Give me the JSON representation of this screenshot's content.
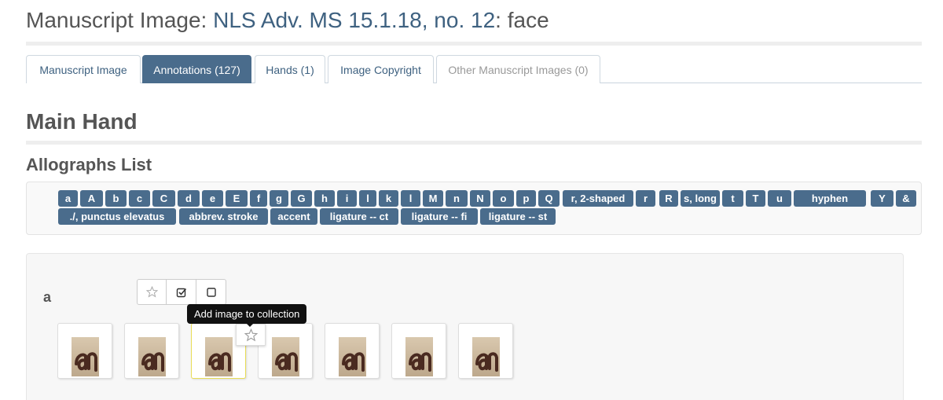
{
  "header": {
    "prefix": "Manuscript Image: ",
    "manuscript": "NLS Adv. MS 15.1.18, no. 12",
    "suffix": ": face"
  },
  "tabs": [
    {
      "label": "Manuscript Image",
      "state": "normal"
    },
    {
      "label": "Annotations (127)",
      "state": "active"
    },
    {
      "label": "Hands (1)",
      "state": "normal"
    },
    {
      "label": "Image Copyright",
      "state": "normal"
    },
    {
      "label": "Other Manuscript Images (0)",
      "state": "disabled"
    }
  ],
  "hand_title": "Main Hand",
  "allographs": {
    "title": "Allographs List",
    "row1": [
      "a",
      "A",
      "b",
      "c",
      "C",
      "d",
      "e",
      "E",
      "f",
      "g",
      "G",
      "h",
      "i",
      "l",
      "k",
      "l",
      "M",
      "n",
      "N",
      "o",
      "p",
      "Q",
      "r, 2-shaped",
      "r",
      "R",
      "s, long",
      "t",
      "T",
      "u",
      "hyphen",
      "Y",
      "&"
    ],
    "row2": [
      "./, punctus elevatus",
      "abbrev. stroke",
      "accent",
      "ligature -- ct",
      "ligature -- fi",
      "ligature -- st"
    ]
  },
  "allograph_group": {
    "letter": "a",
    "tooltip": "Add image to collection",
    "thumbnail_count": 7
  },
  "colors": {
    "accent": "#4a6c8c",
    "link": "#3e6180",
    "text": "#555555"
  },
  "icons": {
    "star": "star-outline",
    "check": "checked-box",
    "uncheck": "empty-box"
  }
}
